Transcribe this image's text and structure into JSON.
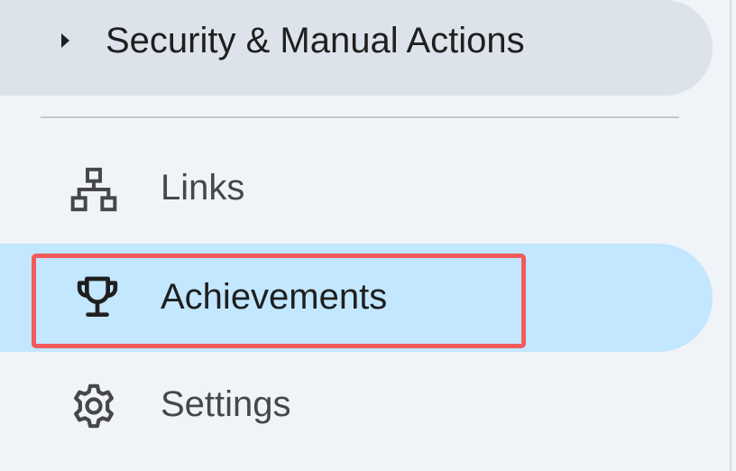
{
  "nav": {
    "security": {
      "label": "Security & Manual Actions",
      "expanded": false,
      "icon": "caret-right-icon"
    },
    "links": {
      "label": "Links",
      "icon": "sitemap-icon"
    },
    "achievements": {
      "label": "Achievements",
      "icon": "trophy-icon",
      "selected": true
    },
    "settings": {
      "label": "Settings",
      "icon": "gear-icon"
    }
  },
  "colors": {
    "page_bg": "#f0f4f9",
    "selected_bg": "#c2e7ff",
    "section_bg": "#dde3ea",
    "highlight_border": "#f25b5b",
    "text": "#1f1f1f",
    "text_secondary": "#474747"
  }
}
